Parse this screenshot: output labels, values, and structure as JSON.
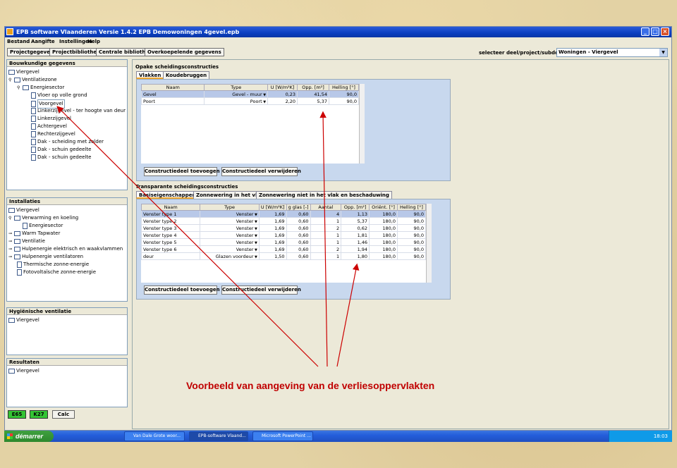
{
  "window": {
    "title": "EPB software Vlaanderen Versie 1.4.2   EPB Demowoningen 4gevel.epb"
  },
  "menu": [
    "Bestand",
    "Aangifte",
    "Instellingen",
    "Help"
  ],
  "toolbar": {
    "buttons": [
      "Projectgegevens",
      "Projectbibliotheek",
      "Centrale bibliotheek",
      "Overkoepelende gegevens"
    ],
    "select_label": "selecteer deel/project/subdossier:",
    "select_value": "Woningen - Viergevel"
  },
  "left": {
    "bouwkundig": {
      "title": "Bouwkundige gegevens",
      "items": [
        "Viergevel",
        "Ventilatiezone",
        "Energiesector",
        "Vloer op volle grond",
        "Voorgevel",
        "Linkerzijgevel - ter hoogte van deur",
        "Linkerzijgevel",
        "Achtergevel",
        "Rechterzijgevel",
        "Dak - scheiding met zolder",
        "Dak - schuin gedeelte",
        "Dak - schuin gedeelte"
      ]
    },
    "installaties": {
      "title": "Installaties",
      "items": [
        "Viergevel",
        "Verwarming en koeling",
        "Energiesector",
        "Warm Tapwater",
        "Ventilatie",
        "Hulpenergie elektrisch en waakvlammen",
        "Hulpenergie ventilatoren",
        "Thermische zonne-energie",
        "Fotovoltaïsche zonne-energie"
      ]
    },
    "hygienisch": {
      "title": "Hygiënische ventilatie",
      "items": [
        "Viergevel"
      ]
    },
    "resultaten": {
      "title": "Resultaten",
      "items": [
        "Viergevel"
      ]
    },
    "summary": {
      "e": "E65",
      "k": "K27",
      "calc": "Calc"
    }
  },
  "opaque": {
    "title": "Opake scheidingsconstructies",
    "tabs": [
      "Vlakken",
      "Koudebruggen"
    ],
    "columns": [
      "Naam",
      "Type",
      "U [W/m²K]",
      "Opp. [m²]",
      "Helling [°]"
    ],
    "rows": [
      {
        "naam": "Gevel",
        "type": "Gevel - muur",
        "u": "0,23",
        "opp": "41,54",
        "helling": "90,0"
      },
      {
        "naam": "Poort",
        "type": "Poort",
        "u": "2,20",
        "opp": "5,37",
        "helling": "90,0"
      }
    ],
    "add": "Constructiedeel toevoegen",
    "remove": "Constructiedeel verwijderen"
  },
  "transparent": {
    "title": "Transparante scheidingsconstructies",
    "tabs": [
      "Basiseigenschappen",
      "Zonnewering in het vlak",
      "Zonnewering niet in het vlak en beschaduwing"
    ],
    "columns": [
      "Naam",
      "Type",
      "U [W/m²K]",
      "g glas [-]",
      "Aantal",
      "Opp. [m²]",
      "Oriënt. [°]",
      "Helling [°]"
    ],
    "rows": [
      {
        "naam": "Venster type 1",
        "type": "Venster",
        "u": "1,69",
        "g": "0,60",
        "aantal": "4",
        "opp": "1,13",
        "orient": "180,0",
        "helling": "90,0"
      },
      {
        "naam": "Venster type 2",
        "type": "Venster",
        "u": "1,69",
        "g": "0,60",
        "aantal": "1",
        "opp": "5,37",
        "orient": "180,0",
        "helling": "90,0"
      },
      {
        "naam": "Venster type 3",
        "type": "Venster",
        "u": "1,69",
        "g": "0,60",
        "aantal": "2",
        "opp": "0,62",
        "orient": "180,0",
        "helling": "90,0"
      },
      {
        "naam": "Venster type 4",
        "type": "Venster",
        "u": "1,69",
        "g": "0,60",
        "aantal": "1",
        "opp": "1,81",
        "orient": "180,0",
        "helling": "90,0"
      },
      {
        "naam": "Venster type 5",
        "type": "Venster",
        "u": "1,69",
        "g": "0,60",
        "aantal": "1",
        "opp": "1,46",
        "orient": "180,0",
        "helling": "90,0"
      },
      {
        "naam": "Venster type 6",
        "type": "Venster",
        "u": "1,69",
        "g": "0,60",
        "aantal": "2",
        "opp": "1,94",
        "orient": "180,0",
        "helling": "90,0"
      },
      {
        "naam": "deur",
        "type": "Glazen voordeur",
        "u": "1,50",
        "g": "0,60",
        "aantal": "1",
        "opp": "1,80",
        "orient": "180,0",
        "helling": "90,0"
      }
    ],
    "add": "Constructiedeel toevoegen",
    "remove": "Constructiedeel verwijderen"
  },
  "caption": "Voorbeeld van aangeving van de verliesoppervlakten",
  "taskbar": {
    "start": "démarrer",
    "tasks": [
      "Van Dale Grote woor...",
      "EPB-software Vlaand...",
      "Microsoft PowerPoint ..."
    ],
    "clock": "18:03"
  },
  "colors": {
    "arrow": "#cc0000",
    "caption": "#c00000"
  }
}
